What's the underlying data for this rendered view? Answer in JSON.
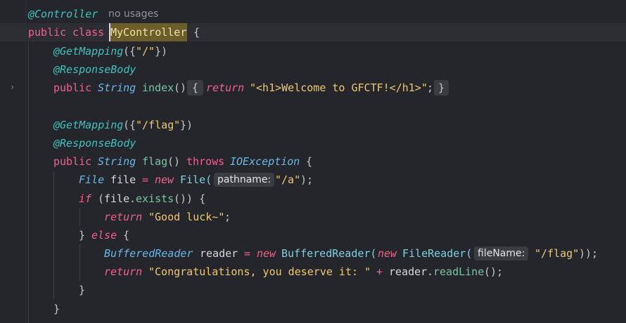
{
  "editor": {
    "line1": {
      "annotation": "@Controller",
      "usages": "no usages"
    },
    "line2": {
      "kw1": "public",
      "kw2": "class",
      "name": "MyController",
      "brace": "{"
    },
    "line3": {
      "annotation": "@GetMapping",
      "open": "({",
      "str": "\"/\"",
      "close": "})"
    },
    "line4": {
      "annotation": "@ResponseBody"
    },
    "line5": {
      "kw": "public",
      "type": "String",
      "fn": "index",
      "parens": "()",
      "lbrace": "{",
      "ret": "return",
      "str": "\"<h1>Welcome to GFCTF!</h1>\"",
      "semi": ";",
      "rbrace": "}"
    },
    "line7": {
      "annotation": "@GetMapping",
      "open": "({",
      "str": "\"/flag\"",
      "close": "})"
    },
    "line8": {
      "annotation": "@ResponseBody"
    },
    "line9": {
      "kw": "public",
      "type": "String",
      "fn": "flag",
      "parens": "()",
      "throws": "throws",
      "exc": "IOException",
      "brace": "{"
    },
    "line10": {
      "type": "File",
      "var": "file",
      "eq": "=",
      "new": "new",
      "cls": "File(",
      "hint": "pathname:",
      "str": "\"/a\"",
      "end": ");"
    },
    "line11": {
      "kw": "if",
      "open": "(",
      "var": "file",
      "dot": ".",
      "fn": "exists",
      "end": "()) {"
    },
    "line12": {
      "ret": "return",
      "str": "\"Good luck~\"",
      "semi": ";"
    },
    "line13": {
      "close": "}",
      "kw": "else",
      "brace": "{"
    },
    "line14": {
      "type": "BufferedReader",
      "var": "reader",
      "eq": "=",
      "new1": "new",
      "cls1": "BufferedReader(",
      "new2": "new",
      "cls2": "FileReader(",
      "hint": "fileName:",
      "str": "\"/flag\"",
      "end": "));"
    },
    "line15": {
      "ret": "return",
      "str": "\"Congratulations, you deserve it: \"",
      "plus": "+",
      "var": "reader",
      "dot": ".",
      "fn": "readLine",
      "end": "();"
    },
    "line16": {
      "close": "}"
    },
    "line17": {
      "close": "}"
    },
    "fold_icon": "chevron-right-icon"
  }
}
